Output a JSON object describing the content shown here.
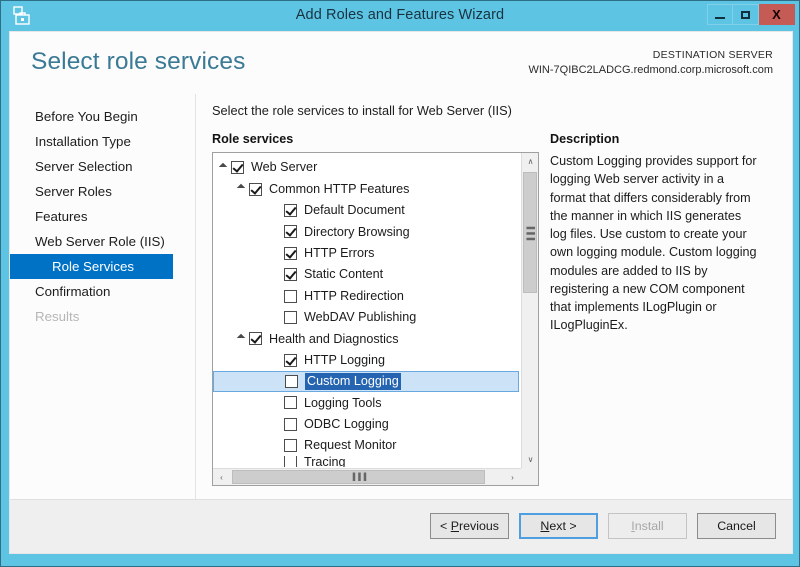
{
  "window": {
    "title": "Add Roles and Features Wizard",
    "icon": "server-toolbox-icon",
    "minimize_label": "Minimize",
    "maximize_label": "Maximize",
    "close_label": "X",
    "accent_color": "#5ec4e4"
  },
  "header": {
    "page_title": "Select role services",
    "destination_label": "DESTINATION SERVER",
    "destination_server": "WIN-7QIBC2LADCG.redmond.corp.microsoft.com"
  },
  "nav": {
    "items": [
      {
        "label": "Before You Begin",
        "state": "normal"
      },
      {
        "label": "Installation Type",
        "state": "normal"
      },
      {
        "label": "Server Selection",
        "state": "normal"
      },
      {
        "label": "Server Roles",
        "state": "normal"
      },
      {
        "label": "Features",
        "state": "normal"
      },
      {
        "label": "Web Server Role (IIS)",
        "state": "normal"
      },
      {
        "label": "Role Services",
        "state": "selected"
      },
      {
        "label": "Confirmation",
        "state": "normal"
      },
      {
        "label": "Results",
        "state": "disabled"
      }
    ],
    "selected_color": "#0072c6"
  },
  "main": {
    "instruction": "Select the role services to install for Web Server (IIS)",
    "role_services_label": "Role services",
    "description_label": "Description",
    "description_text": "Custom Logging provides support for logging Web server activity in a format that differs considerably from the manner in which IIS generates log files. Use custom to create your own logging module. Custom logging modules are added to IIS by registering a new COM component that implements ILogPlugin or ILogPluginEx.",
    "tree": [
      {
        "label": "Web Server",
        "indent": 0,
        "checked": true,
        "expander": "open",
        "selected": false
      },
      {
        "label": "Common HTTP Features",
        "indent": 1,
        "checked": true,
        "expander": "open",
        "selected": false
      },
      {
        "label": "Default Document",
        "indent": 2,
        "checked": true,
        "expander": "none",
        "selected": false
      },
      {
        "label": "Directory Browsing",
        "indent": 2,
        "checked": true,
        "expander": "none",
        "selected": false
      },
      {
        "label": "HTTP Errors",
        "indent": 2,
        "checked": true,
        "expander": "none",
        "selected": false
      },
      {
        "label": "Static Content",
        "indent": 2,
        "checked": true,
        "expander": "none",
        "selected": false
      },
      {
        "label": "HTTP Redirection",
        "indent": 2,
        "checked": false,
        "expander": "none",
        "selected": false
      },
      {
        "label": "WebDAV Publishing",
        "indent": 2,
        "checked": false,
        "expander": "none",
        "selected": false
      },
      {
        "label": "Health and Diagnostics",
        "indent": 1,
        "checked": true,
        "expander": "open",
        "selected": false
      },
      {
        "label": "HTTP Logging",
        "indent": 2,
        "checked": true,
        "expander": "none",
        "selected": false
      },
      {
        "label": "Custom Logging",
        "indent": 2,
        "checked": false,
        "expander": "none",
        "selected": true
      },
      {
        "label": "Logging Tools",
        "indent": 2,
        "checked": false,
        "expander": "none",
        "selected": false
      },
      {
        "label": "ODBC Logging",
        "indent": 2,
        "checked": false,
        "expander": "none",
        "selected": false
      },
      {
        "label": "Request Monitor",
        "indent": 2,
        "checked": false,
        "expander": "none",
        "selected": false
      },
      {
        "label": "Tracing",
        "indent": 2,
        "checked": false,
        "expander": "none",
        "selected": false,
        "clipped": true
      }
    ],
    "selection_highlight_color": "#2564b0",
    "selection_row_color": "#cce3f7",
    "scroll": {
      "up_arrow": "∧",
      "down_arrow": "∨",
      "left_arrow": "‹",
      "right_arrow": "›",
      "grip": "▐▐▐"
    }
  },
  "footer": {
    "buttons": [
      {
        "label": "< Previous",
        "state": "normal",
        "accesskey": "P"
      },
      {
        "label": "Next >",
        "state": "focused",
        "accesskey": "N"
      },
      {
        "label": "Install",
        "state": "disabled",
        "accesskey": "I"
      },
      {
        "label": "Cancel",
        "state": "normal",
        "accesskey": ""
      }
    ]
  }
}
